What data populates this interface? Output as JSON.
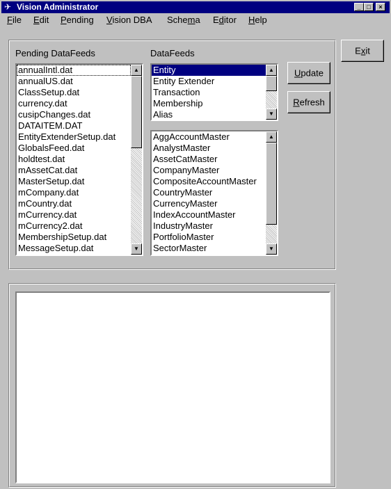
{
  "window": {
    "title": "Vision Administrator",
    "app_icon": "airplane-icon"
  },
  "menu": [
    {
      "pre": "",
      "hot": "F",
      "post": "ile"
    },
    {
      "pre": "",
      "hot": "E",
      "post": "dit"
    },
    {
      "pre": "",
      "hot": "P",
      "post": "ending"
    },
    {
      "pre": "",
      "hot": "V",
      "post": "ision DBA"
    },
    {
      "pre": "Sche",
      "hot": "m",
      "post": "a"
    },
    {
      "pre": "E",
      "hot": "d",
      "post": "itor"
    },
    {
      "pre": "",
      "hot": "H",
      "post": "elp"
    }
  ],
  "pending": {
    "label": "Pending DataFeeds",
    "items": [
      "annualIntl.dat",
      "annualUS.dat",
      "ClassSetup.dat",
      "currency.dat",
      "cusipChanges.dat",
      "DATAITEM.DAT",
      "EntityExtenderSetup.dat",
      "GlobalsFeed.dat",
      "holdtest.dat",
      "mAssetCat.dat",
      "MasterSetup.dat",
      "mCompany.dat",
      "mCountry.dat",
      "mCurrency.dat",
      "mCurrency2.dat",
      "MembershipSetup.dat",
      "MessageSetup.dat"
    ]
  },
  "datafeeds": {
    "label": "DataFeeds",
    "types": [
      "Entity",
      "Entity Extender",
      "Transaction",
      "Membership",
      "Alias"
    ],
    "selected_type": "Entity",
    "masters": [
      "AggAccountMaster",
      "AnalystMaster",
      "AssetCatMaster",
      "CompanyMaster",
      "CompositeAccountMaster",
      "CountryMaster",
      "CurrencyMaster",
      "IndexAccountMaster",
      "IndustryMaster",
      "PortfolioMaster",
      "SectorMaster"
    ]
  },
  "buttons": {
    "update": {
      "hot": "U",
      "post": "pdate"
    },
    "refresh": {
      "hot": "R",
      "post": "efresh"
    },
    "exit": {
      "pre": "E",
      "hot": "x",
      "post": "it"
    }
  },
  "icons": {
    "minimize": "minimize-icon",
    "maximize": "maximize-icon",
    "close": "close-icon",
    "scroll_up": "up-arrow-icon",
    "scroll_down": "down-arrow-icon"
  }
}
